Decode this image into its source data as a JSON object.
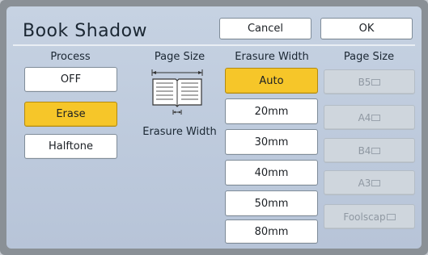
{
  "title": "Book Shadow",
  "header": {
    "cancel_label": "Cancel",
    "ok_label": "OK"
  },
  "process": {
    "heading": "Process",
    "options": [
      "OFF",
      "Erase",
      "Halftone"
    ],
    "selected": "Erase"
  },
  "page_size_panel": {
    "heading": "Page Size",
    "caption": "Erasure Width",
    "icon": "open-book-icon"
  },
  "erasure_width": {
    "heading": "Erasure Width",
    "options": [
      "Auto",
      "20mm",
      "30mm",
      "40mm",
      "50mm",
      "80mm"
    ],
    "selected": "Auto"
  },
  "page_size": {
    "heading": "Page Size",
    "options": [
      "B5",
      "A4",
      "B4",
      "A3",
      "Foolscap"
    ],
    "orientation_icon": "landscape-page-icon",
    "enabled": false
  },
  "colors": {
    "panel_bg": "#bdc9dc",
    "selected": "#f6c629",
    "button": "#ffffff",
    "disabled_button": "#cfd6dd"
  }
}
